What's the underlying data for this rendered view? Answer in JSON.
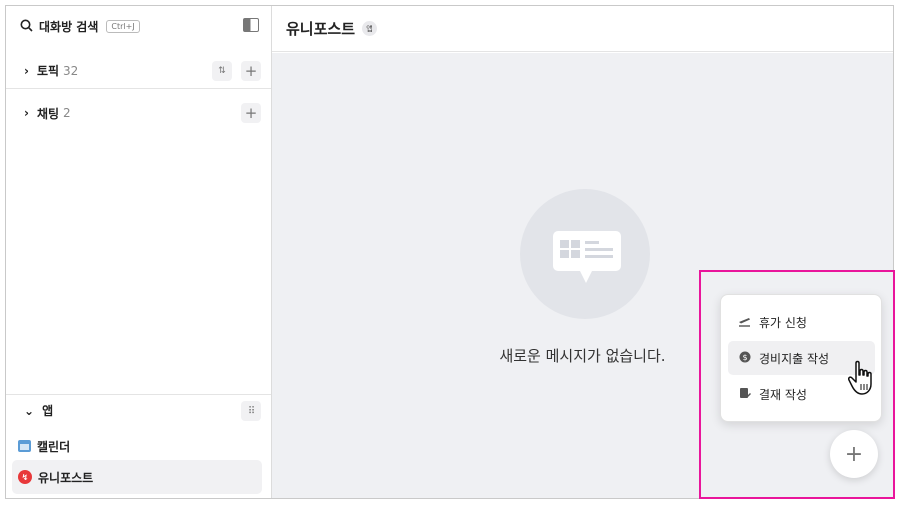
{
  "sidebar": {
    "search": {
      "label": "대화방 검색",
      "shortcut": "Ctrl+J"
    },
    "sections": {
      "topic": {
        "label": "토픽",
        "count": "32"
      },
      "chat": {
        "label": "채팅",
        "count": "2"
      }
    },
    "apps": {
      "label": "앱",
      "items": [
        {
          "label": "캘린더"
        },
        {
          "label": "유니포스트"
        }
      ]
    }
  },
  "main": {
    "title": "유니포스트",
    "badge": "앱",
    "empty_message": "새로운 메시지가 없습니다."
  },
  "menu": {
    "items": [
      {
        "label": "휴가 신청"
      },
      {
        "label": "경비지출 작성"
      },
      {
        "label": "결재 작성"
      }
    ]
  },
  "colors": {
    "highlight": "#e9159b",
    "uniipost_icon": "#e8383a",
    "calendar_icon": "#5b9cd6",
    "main_bg": "#eff0f3"
  }
}
